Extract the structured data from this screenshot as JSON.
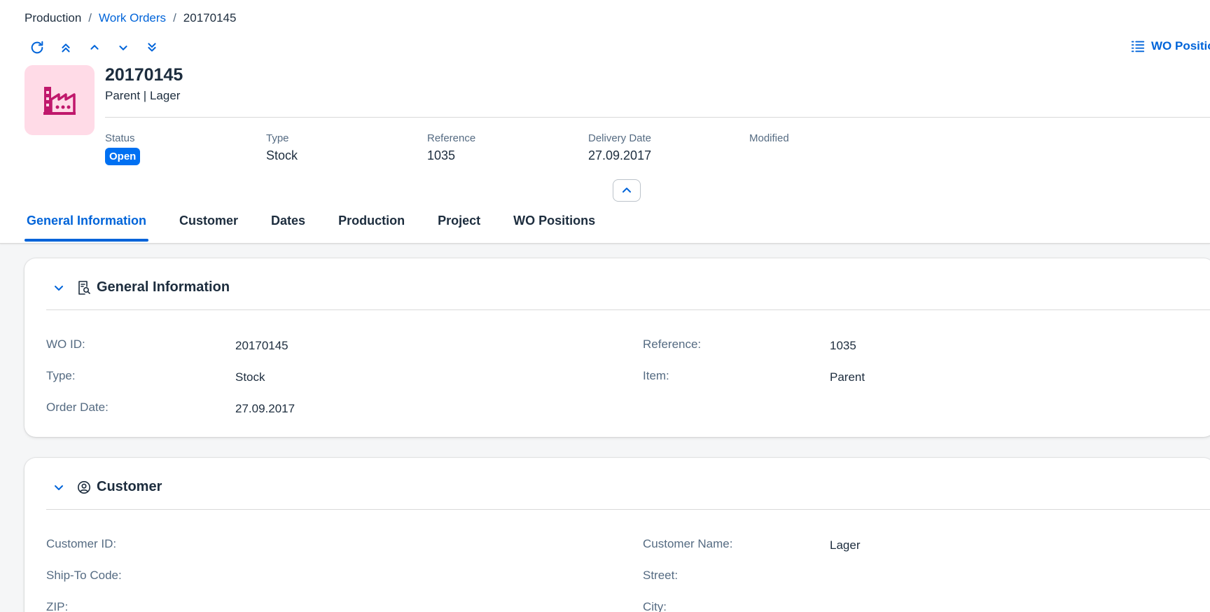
{
  "breadcrumb": {
    "items": [
      {
        "label": "Production"
      },
      {
        "label": "Work Orders"
      },
      {
        "label": "20170145"
      }
    ],
    "separator": "/"
  },
  "toolbar": {
    "icons": [
      "refresh-icon",
      "double-chevron-up-icon",
      "chevron-up-icon",
      "chevron-down-icon",
      "double-chevron-down-icon"
    ],
    "wo_positions_label": "WO Positio"
  },
  "object": {
    "title": "20170145",
    "subtitle": "Parent | Lager",
    "avatar_icon": "factory-icon",
    "avatar_bg": "#ffdbe7",
    "avatar_color": "#c0186c"
  },
  "kpis": {
    "status": {
      "label": "Status",
      "value": "Open"
    },
    "type": {
      "label": "Type",
      "value": "Stock"
    },
    "reference": {
      "label": "Reference",
      "value": "1035"
    },
    "delivery_date": {
      "label": "Delivery Date",
      "value": "27.09.2017"
    },
    "modified": {
      "label": "Modified",
      "value": ""
    }
  },
  "tabs": [
    {
      "label": "General Information",
      "active": true
    },
    {
      "label": "Customer"
    },
    {
      "label": "Dates"
    },
    {
      "label": "Production"
    },
    {
      "label": "Project"
    },
    {
      "label": "WO Positions"
    }
  ],
  "general": {
    "title": "General Information",
    "fields": {
      "wo_id": {
        "label": "WO ID:",
        "value": "20170145"
      },
      "type": {
        "label": "Type:",
        "value": "Stock"
      },
      "order_date": {
        "label": "Order Date:",
        "value": "27.09.2017"
      },
      "reference": {
        "label": "Reference:",
        "value": "1035"
      },
      "item": {
        "label": "Item:",
        "value": "Parent"
      }
    }
  },
  "customer": {
    "title": "Customer",
    "fields": {
      "customer_id": {
        "label": "Customer ID:",
        "value": ""
      },
      "ship_to_code": {
        "label": "Ship-To Code:",
        "value": ""
      },
      "zip": {
        "label": "ZIP:",
        "value": ""
      },
      "customer_name": {
        "label": "Customer Name:",
        "value": "Lager"
      },
      "street": {
        "label": "Street:",
        "value": ""
      },
      "city": {
        "label": "City:",
        "value": ""
      }
    }
  },
  "colors": {
    "accent": "#0064d9",
    "status_badge": "#0070f2",
    "label": "#556b82",
    "text": "#1d2d3e",
    "page_bg": "#f5f6f7"
  }
}
